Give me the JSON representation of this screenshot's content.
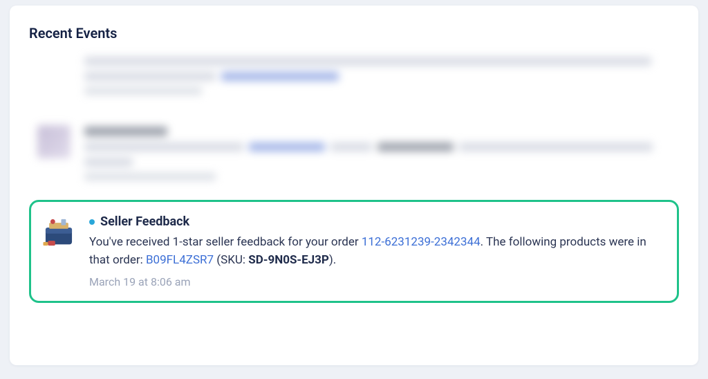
{
  "panel": {
    "title": "Recent Events"
  },
  "events": {
    "highlighted": {
      "title": "Seller Feedback",
      "text_prefix": "You've received 1-star seller feedback for your order ",
      "order_link": "112-6231239-2342344",
      "text_mid": ". The following products were in that order: ",
      "asin_link": "B09FL4ZSR7",
      "sku_label_open": " (SKU: ",
      "sku_value": "SD-9N0S-EJ3P",
      "sku_label_close": ").",
      "timestamp": "March 19 at 8:06 am",
      "icon_name": "seller-feedback-box-icon"
    }
  }
}
